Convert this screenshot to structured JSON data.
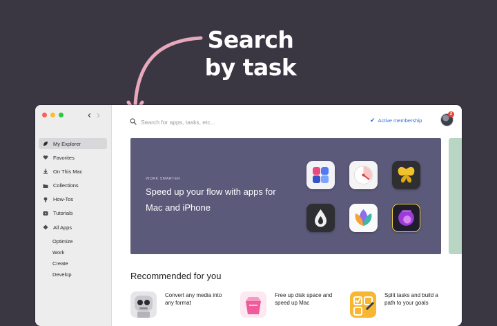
{
  "headline": {
    "line1": "Search",
    "line2": "by task"
  },
  "window": {
    "nav": {
      "back": "‹",
      "forward": "›"
    },
    "sidebar": {
      "items": [
        {
          "label": "My Explorer",
          "icon": "leaf-icon",
          "active": true
        },
        {
          "label": "Favorites",
          "icon": "heart-icon"
        },
        {
          "label": "On This Mac",
          "icon": "download-icon"
        },
        {
          "label": "Collections",
          "icon": "folder-icon"
        },
        {
          "label": "How-Tos",
          "icon": "lightbulb-icon"
        },
        {
          "label": "Tutorials",
          "icon": "play-icon"
        },
        {
          "label": "All Apps",
          "icon": "diamond-icon"
        }
      ],
      "subitems": [
        "Optimize",
        "Work",
        "Create",
        "Develop"
      ]
    },
    "search": {
      "placeholder": "Search for apps, tasks, etc..."
    },
    "membership": {
      "label": "Active membership"
    },
    "notifications": {
      "count": "2"
    },
    "banner": {
      "eyebrow": "WORK SMARTER",
      "title": "Speed up your flow with apps for Mac and iPhone",
      "apps": [
        "mosaic-app-icon",
        "timer-app-icon",
        "butterfly-app-icon",
        "drop-app-icon",
        "flower-app-icon",
        "circle-app-icon"
      ]
    },
    "recommended": {
      "title": "Recommended for you",
      "items": [
        {
          "text": "Convert any media into any format",
          "icon": "robot-app-icon"
        },
        {
          "text": "Free up disk space and speed up Mac",
          "icon": "cleaner-app-icon"
        },
        {
          "text": "Split tasks and build a path to your goals",
          "icon": "tasks-app-icon"
        }
      ]
    }
  }
}
